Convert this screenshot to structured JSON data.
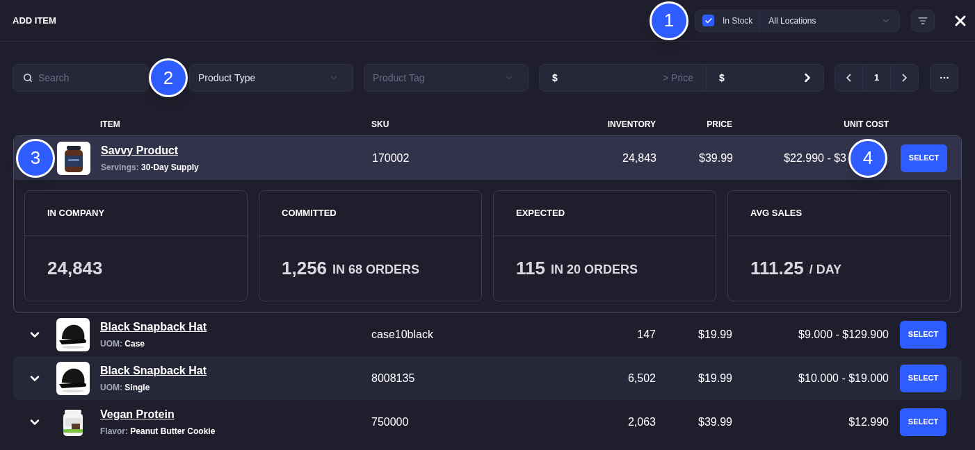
{
  "header": {
    "title": "ADD ITEM",
    "callout": "1",
    "in_stock": {
      "label": "In Stock",
      "checked": true
    },
    "location": {
      "value": "All Locations"
    }
  },
  "filters": {
    "search": {
      "placeholder": "Search"
    },
    "callout": "2",
    "product_type": {
      "value": "Product Type"
    },
    "product_tag": {
      "placeholder": "Product Tag"
    },
    "price_min": {
      "symbol": "$",
      "placeholder": "> Price"
    },
    "price_max": {
      "symbol": "$"
    },
    "page": "1"
  },
  "table": {
    "columns": [
      "ITEM",
      "SKU",
      "INVENTORY",
      "PRICE",
      "UNIT COST"
    ],
    "rows": [
      {
        "name": "Savvy Product",
        "attr_label": "Servings:",
        "attr_value": "30-Day Supply",
        "sku": "170002",
        "inventory": "24,843",
        "price": "$39.99",
        "unit_cost": "$22.990 - $3",
        "button": "SELECT",
        "expanded": true,
        "callout": "3",
        "button_callout": "4",
        "stats": [
          {
            "label": "IN COMPANY",
            "value": "24,843"
          },
          {
            "label": "COMMITTED",
            "value": "1,256",
            "suffix": "IN 68 ORDERS"
          },
          {
            "label": "EXPECTED",
            "value": "115",
            "suffix": "IN 20 ORDERS"
          },
          {
            "label": "AVG SALES",
            "value": "111.25",
            "suffix": "/ DAY"
          }
        ]
      },
      {
        "name": "Black Snapback Hat",
        "attr_label": "UOM:",
        "attr_value": "Case",
        "sku": "case10black",
        "inventory": "147",
        "price": "$19.99",
        "unit_cost": "$9.000 - $129.900",
        "button": "SELECT",
        "expanded": false,
        "highlighted": false
      },
      {
        "name": "Black Snapback Hat",
        "attr_label": "UOM:",
        "attr_value": "Single",
        "sku": "8008135",
        "inventory": "6,502",
        "price": "$19.99",
        "unit_cost": "$10.000 - $19.000",
        "button": "SELECT",
        "expanded": false,
        "highlighted": true
      },
      {
        "name": "Vegan Protein",
        "attr_label": "Flavor:",
        "attr_value": "Peanut Butter Cookie",
        "sku": "750000",
        "inventory": "2,063",
        "price": "$39.99",
        "unit_cost": "$12.990",
        "button": "SELECT",
        "expanded": false,
        "highlighted": false
      }
    ]
  }
}
